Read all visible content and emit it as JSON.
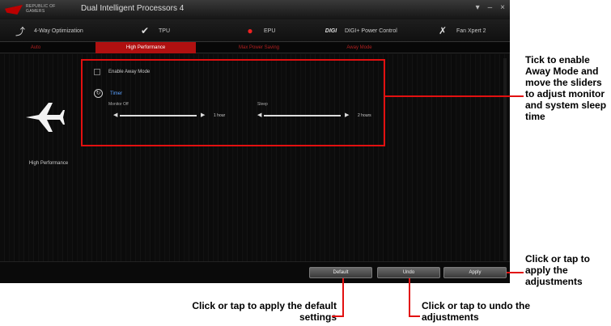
{
  "window": {
    "title": "Dual Intelligent Processors 4",
    "brand": "REPUBLIC OF GAMERS",
    "controls": [
      "▾",
      "–",
      "×"
    ]
  },
  "toolbar": {
    "items": [
      {
        "label": "4-Way Optimization",
        "icon": "4way-icon"
      },
      {
        "label": "TPU",
        "icon": "tpu-icon"
      },
      {
        "label": "EPU",
        "icon": "epu-icon"
      },
      {
        "label": "DIGI+ Power Control",
        "icon": "digi-icon"
      },
      {
        "label": "Fan Xpert 2",
        "icon": "fan-icon"
      }
    ],
    "active": "EPU"
  },
  "subtabs": [
    "Auto",
    "High Performance",
    "Max Power Saving",
    "Away Mode"
  ],
  "active_subtab": "High Performance",
  "mode": {
    "label": "High Performance",
    "icon": "airplane-icon"
  },
  "away": {
    "enable_label": "Enable Away Mode",
    "timer_label": "Timer",
    "monitor_off": {
      "label": "Monitor Off",
      "value": "1 hour"
    },
    "sleep": {
      "label": "Sleep",
      "value": "2 hours"
    }
  },
  "buttons": {
    "default": "Default",
    "undo": "Undo",
    "apply": "Apply"
  },
  "callouts": {
    "away": "Tick to enable Away Mode and move the sliders to adjust monitor and system sleep time",
    "apply": "Click or tap to apply the adjustments",
    "default": "Click or tap to apply the default settings",
    "undo": "Click or tap to undo the adjustments"
  },
  "colors": {
    "accent": "#e21010",
    "active_tab": "#b01010",
    "timer": "#5aa0ff"
  }
}
